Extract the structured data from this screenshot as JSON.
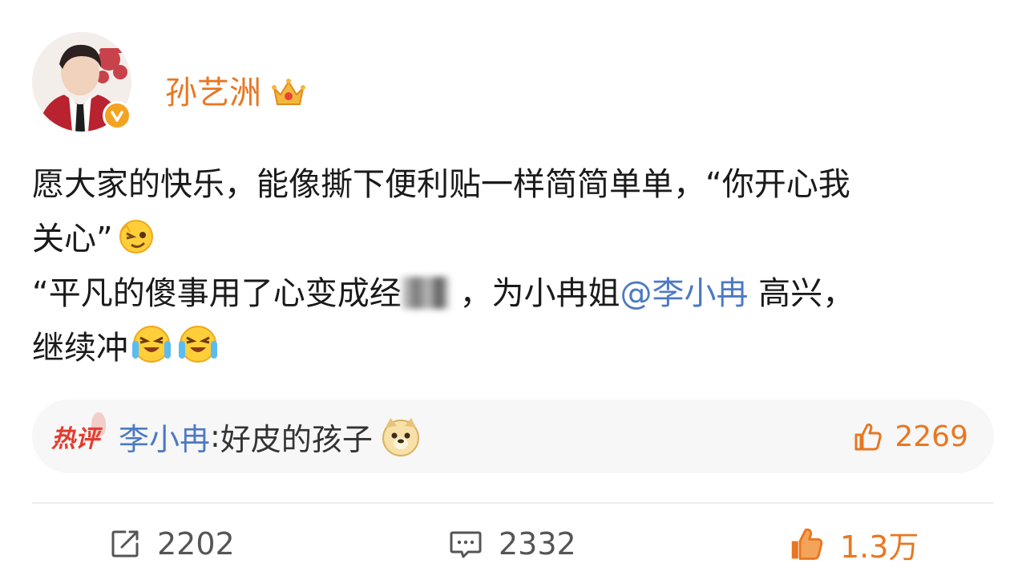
{
  "post": {
    "author": {
      "name": "孙艺洲",
      "avatar_icon": "avatar",
      "verified_icon": "verified-badge-icon",
      "member_icon": "crown-icon"
    },
    "content": {
      "line1": "愿大家的快乐，能像撕下便利贴一样简简单单，“你开心我",
      "line2": "关心”",
      "line3_a": "“平凡的傻事用了心变成经",
      "line3_b": "，为小冉姐",
      "mention": "@李小冉",
      "line3_c": "高兴，",
      "line4": "继续冲"
    },
    "hot_comment": {
      "badge": "热评",
      "commenter": "李小冉",
      "separator": ": ",
      "text": "好皮的孩子",
      "likes": "2269"
    },
    "actions": {
      "reposts": "2202",
      "comments": "2332",
      "likes": "1.3万"
    }
  },
  "colors": {
    "accent": "#e87722",
    "link": "#4c7ac4",
    "hot": "#e43b2f"
  }
}
